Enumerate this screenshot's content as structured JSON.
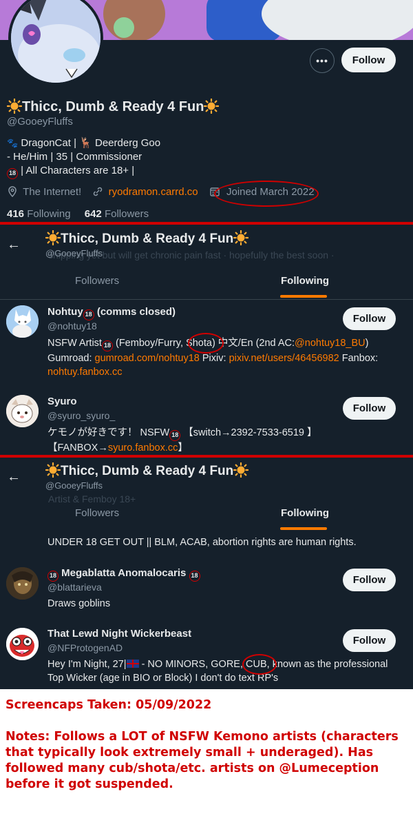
{
  "profile": {
    "display_name": "Thicc, Dumb & Ready 4 Fun",
    "handle": "@GooeyFluffs",
    "bio_line1_a": "DragonCat |",
    "bio_line1_b": "Deerderg Goo",
    "bio_line2": "- He/Him | 35 | Commissioner",
    "bio_line3": "| All Characters are 18+ |",
    "location": "The Internet!",
    "website": "ryodramon.carrd.co",
    "joined": "Joined March 2022",
    "following_count": "416",
    "following_label": "Following",
    "followers_count": "642",
    "followers_label": "Followers",
    "follow_button": "Follow"
  },
  "header2": {
    "name": "Thicc, Dumb & Ready 4 Fun",
    "handle": "@GooeyFluffs",
    "tab_followers": "Followers",
    "tab_following": "Following"
  },
  "users1": [
    {
      "name": "Nohtuy",
      "name_suffix": "(comms closed)",
      "handle": "@nohtuy18",
      "bio_a": "NSFW Artist",
      "bio_b": "(Femboy/Furry,",
      "bio_c": "Shota",
      "bio_d": ") 中文/En (2nd AC:",
      "bio_link1": "@nohtuy18_BU",
      "bio_e": ")",
      "bio_f": "Gumroad:",
      "bio_link2": "gumroad.com/nohtuy18",
      "bio_g": "Pixiv:",
      "bio_link3": "pixiv.net/users/46456982",
      "bio_h": "Fanbox:",
      "bio_link4": "nohtuy.fanbox.cc",
      "follow": "Follow"
    },
    {
      "name": "Syuro",
      "handle": "@syuro_syuro_",
      "bio_a": "ケモノが好きです！ NSFW",
      "bio_b": "【switch→2392-7533-6519 】",
      "bio_c": "【FANBOX→",
      "bio_link": "syuro.fanbox.cc",
      "bio_d": "】",
      "follow": "Follow"
    }
  ],
  "users2": [
    {
      "bio_cut": "UNDER 18 GET OUT || BLM, ACAB, abortion rights are human rights."
    },
    {
      "name": "Megablatta Anomalocaris",
      "handle": "@blattarieva",
      "bio": "Draws goblins",
      "follow": "Follow"
    },
    {
      "name": "That Lewd Night Wickerbeast",
      "handle": "@NFProtogenAD",
      "bio_a": "Hey I'm Night, 27|",
      "bio_b": "- NO MINORS, GORE,",
      "bio_c": "CUB",
      "bio_d": ", known as the professional",
      "bio_e": "Top Wicker (age in BIO or Block) I don't do text RP's",
      "follow": "Follow"
    }
  ],
  "badge18": "18",
  "notes": {
    "line1": "Screencaps Taken: 05/09/2022",
    "line2": "Notes: Follows a LOT of NSFW Kemono artists (characters that typically look extremely small + underaged). Has followed many cub/shota/etc. artists on @Lumeception before it got suspended."
  },
  "colors": {
    "bg": "#15202b",
    "accent": "#ff7a00",
    "annotation_red": "#d00000"
  }
}
